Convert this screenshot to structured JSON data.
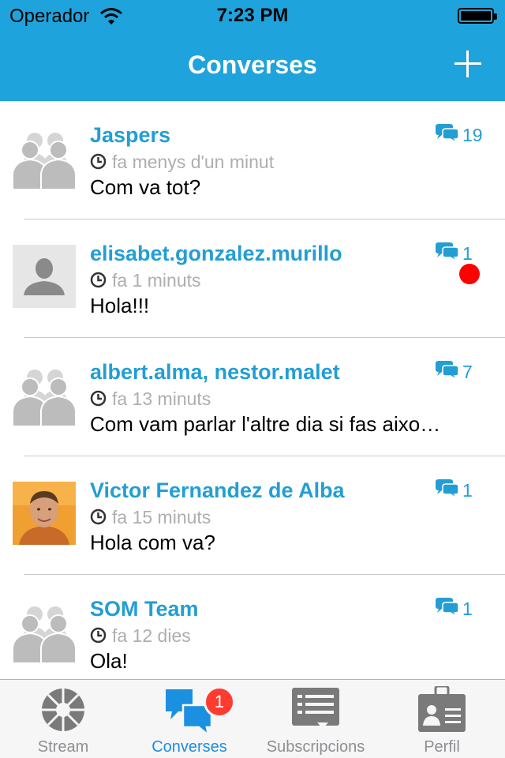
{
  "status_bar": {
    "carrier": "Operador",
    "time": "7:23 PM"
  },
  "header": {
    "title": "Converses",
    "add_icon": "plus-icon"
  },
  "conversations": [
    {
      "name": "Jaspers",
      "ago": "fa menys d'un minut",
      "message": "Com va tot?",
      "count": "19",
      "avatar": "group-avatar",
      "unread": false
    },
    {
      "name": "elisabet.gonzalez.murillo",
      "ago": "fa 1 minuts",
      "message": "Hola!!!",
      "count": "1",
      "avatar": "person-placeholder",
      "unread": true
    },
    {
      "name": "albert.alma, nestor.malet",
      "ago": "fa 13 minuts",
      "message": "Com vam parlar l'altre dia si fas aixo…",
      "count": "7",
      "avatar": "group-avatar",
      "unread": false
    },
    {
      "name": "Victor Fernandez de Alba",
      "ago": "fa 15 minuts",
      "message": "Hola com va?",
      "count": "1",
      "avatar": "photo",
      "unread": false
    },
    {
      "name": "SOM Team",
      "ago": "fa 12 dies",
      "message": "Ola!",
      "count": "1",
      "avatar": "group-avatar",
      "unread": false
    }
  ],
  "tabbar": {
    "tabs": [
      {
        "label": "Stream",
        "icon": "stream-wheel-icon",
        "active": false
      },
      {
        "label": "Converses",
        "icon": "chat-bubbles-icon",
        "active": true,
        "badge": "1"
      },
      {
        "label": "Subscripcions",
        "icon": "list-icon",
        "active": false
      },
      {
        "label": "Perfil",
        "icon": "id-card-icon",
        "active": false
      }
    ]
  },
  "colors": {
    "accent": "#1fa3dc",
    "link": "#239ed4",
    "unread": "#ff0000",
    "badge": "#ff3b30",
    "tab_active": "#1b8fe0"
  }
}
